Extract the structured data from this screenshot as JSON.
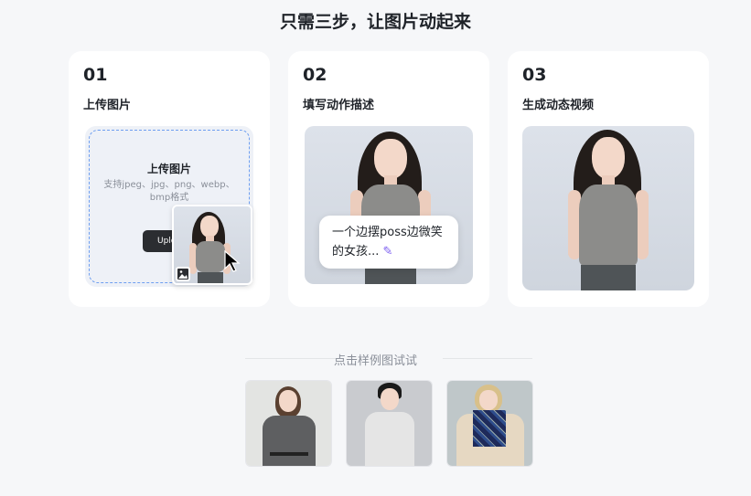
{
  "page": {
    "title": "只需三步，让图片动起来"
  },
  "steps": [
    {
      "num": "01",
      "title": "上传图片"
    },
    {
      "num": "02",
      "title": "填写动作描述"
    },
    {
      "num": "03",
      "title": "生成动态视频"
    }
  ],
  "upload": {
    "title": "上传图片",
    "hint": "支持jpeg、jpg、png、webp、bmp格式",
    "button_label": "Upload"
  },
  "prompt_example": {
    "text": "一个边摆poss边微笑的女孩..."
  },
  "samples": {
    "label": "点击样例图试试"
  },
  "colors": {
    "accent": "#6d9ef0",
    "button": "#2b2d31",
    "background": "#f6f7f9"
  },
  "icons": [
    "image-icon",
    "cursor-icon",
    "pen-icon"
  ]
}
